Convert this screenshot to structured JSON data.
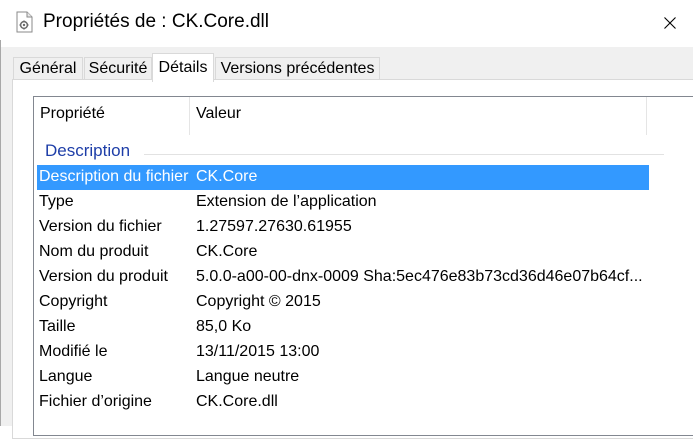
{
  "window": {
    "title": "Propriétés de : CK.Core.dll",
    "icon": "dll-file-icon",
    "close_glyph": "close-icon"
  },
  "tabs": [
    {
      "label": "Général",
      "active": false
    },
    {
      "label": "Sécurité",
      "active": false
    },
    {
      "label": "Détails",
      "active": true
    },
    {
      "label": "Versions précédentes",
      "active": false
    }
  ],
  "list": {
    "headers": {
      "property": "Propriété",
      "value": "Valeur"
    },
    "group": "Description",
    "rows": [
      {
        "name": "Description du fichier",
        "value": "CK.Core",
        "selected": true
      },
      {
        "name": "Type",
        "value": "Extension de l’application"
      },
      {
        "name": "Version du fichier",
        "value": "1.27597.27630.61955"
      },
      {
        "name": "Nom du produit",
        "value": "CK.Core"
      },
      {
        "name": "Version du produit",
        "value": "5.0.0-a00-00-dnx-0009 Sha:5ec476e83b73cd36d46e07b64cf..."
      },
      {
        "name": "Copyright",
        "value": "Copyright ©  2015"
      },
      {
        "name": "Taille",
        "value": "85,0 Ko"
      },
      {
        "name": "Modifié le",
        "value": "13/11/2015 13:00"
      },
      {
        "name": "Langue",
        "value": "Langue neutre"
      },
      {
        "name": "Fichier d’origine",
        "value": "CK.Core.dll"
      }
    ]
  },
  "colors": {
    "selection": "#3399ff",
    "group_label": "#1e3ea8",
    "highlighter": "#fff878"
  }
}
